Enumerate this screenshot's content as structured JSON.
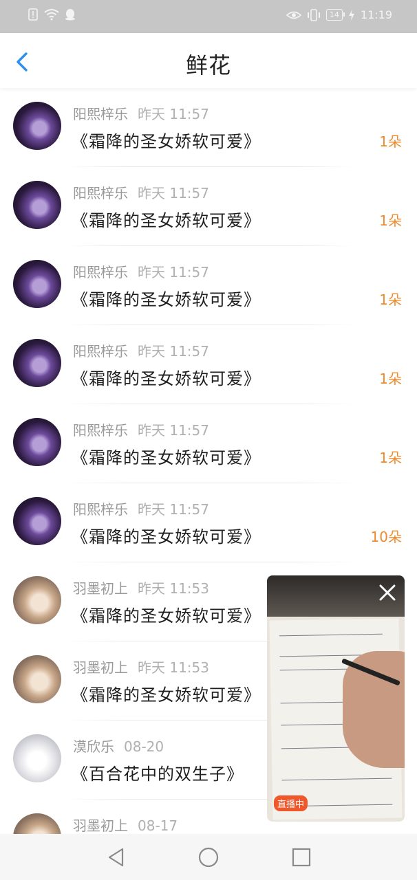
{
  "status_bar": {
    "battery": "14",
    "time": "11:19"
  },
  "header": {
    "title": "鲜花"
  },
  "rows": [
    {
      "name": "阳熙梓乐",
      "time": "昨天  11:57",
      "book": "《霜降的圣女娇软可爱》",
      "count": "1朵"
    },
    {
      "name": "阳熙梓乐",
      "time": "昨天  11:57",
      "book": "《霜降的圣女娇软可爱》",
      "count": "1朵"
    },
    {
      "name": "阳熙梓乐",
      "time": "昨天  11:57",
      "book": "《霜降的圣女娇软可爱》",
      "count": "1朵"
    },
    {
      "name": "阳熙梓乐",
      "time": "昨天  11:57",
      "book": "《霜降的圣女娇软可爱》",
      "count": "1朵"
    },
    {
      "name": "阳熙梓乐",
      "time": "昨天  11:57",
      "book": "《霜降的圣女娇软可爱》",
      "count": "1朵"
    },
    {
      "name": "阳熙梓乐",
      "time": "昨天  11:57",
      "book": "《霜降的圣女娇软可爱》",
      "count": "10朵"
    },
    {
      "name": "羽墨初上",
      "time": "昨天  11:53",
      "book": "《霜降的圣女娇软可爱》",
      "count": ""
    },
    {
      "name": "羽墨初上",
      "time": "昨天  11:53",
      "book": "《霜降的圣女娇软可爱》",
      "count": ""
    },
    {
      "name": "漠欣乐",
      "time": "08-20",
      "book": "《百合花中的双生子》",
      "count": ""
    },
    {
      "name": "羽墨初上",
      "time": "08-17",
      "book": "",
      "count": ""
    }
  ],
  "live_window": {
    "badge": "直播中"
  },
  "colors": {
    "accent_blue": "#2f8ff0",
    "count_orange": "#f08a2c",
    "live_badge": "#f0582b"
  }
}
